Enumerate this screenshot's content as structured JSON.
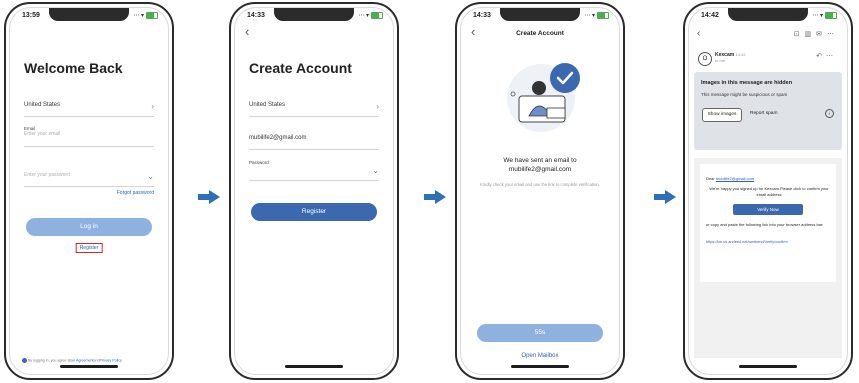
{
  "screens": [
    {
      "time": "13:59",
      "title": "Welcome Back",
      "country": "United States",
      "email_label": "Email",
      "email_placeholder": "Enter your email",
      "password_placeholder": "Enter your password",
      "forgot_password": "Forgot password",
      "login_button": "Log in",
      "register_link": "Register",
      "agreement_prefix": "By logging in, you agree",
      "agreement_link1": "User Agreement",
      "agreement_and": "and",
      "agreement_link2": "Privacy Policy"
    },
    {
      "time": "14:33",
      "title": "Create Account",
      "country": "United States",
      "email_value": "mubilife2@gmail.com",
      "password_label": "Password",
      "register_button": "Register"
    },
    {
      "time": "14:33",
      "title": "Create Account",
      "message_line1": "We have sent an email to",
      "message_email": "mubilife2@gmail.com",
      "hint": "Kindly check your email and use the link to complete verification.",
      "countdown_button": "55s",
      "open_mailbox": "Open Mailbox"
    },
    {
      "time": "14:42",
      "sender_initial": "O",
      "sender": "Kexcam",
      "sender_time": "14:42",
      "recipient": "to me",
      "warning_title": "Images in this message are hidden",
      "warning_text": "This message might be suspicious or spam",
      "show_images": "Show images",
      "report_spam": "Report spam",
      "dear": "Dear",
      "dear_email": "mubilife2@gmail.com",
      "body1": "We're happy you signed up for Kexcam.Please click to confirm your email address",
      "verify_button": "Verify Now",
      "body2": "or copy and paste the following link into your browser address bar:",
      "link": "https://icn.us.arcfeed.net/weekend/Verify/confirm"
    }
  ],
  "colors": {
    "arrow": "#2f6fb6",
    "button_dark": "#3a69b0",
    "button_light": "#8fb1e0",
    "link": "#2a62c8",
    "highlight_box": "#d9262c"
  }
}
